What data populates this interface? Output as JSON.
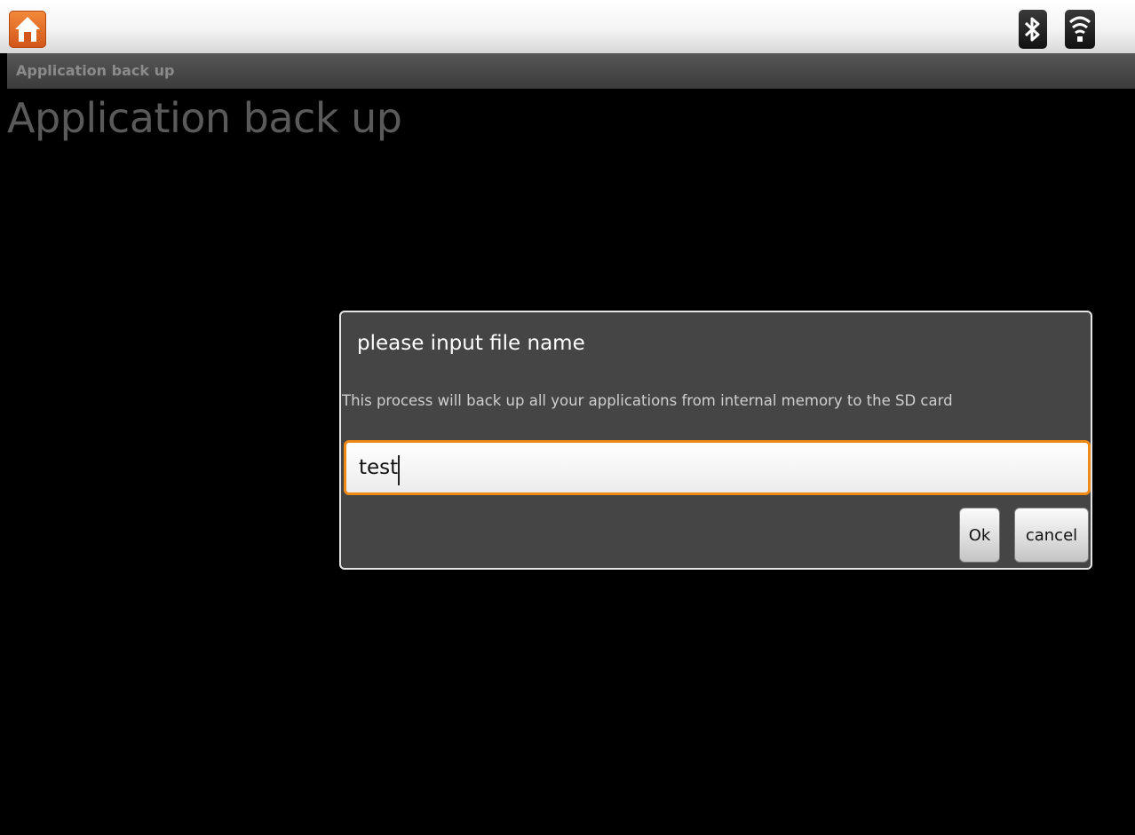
{
  "status_bar": {
    "icons": [
      "home-icon",
      "bluetooth-icon",
      "wifi-icon"
    ],
    "accent": "#e2651f"
  },
  "title_bar": {
    "label": "Application back up"
  },
  "page": {
    "title": "Application back up"
  },
  "dialog": {
    "title": "please input file name",
    "message": "This process will back up all your applications from internal memory to the SD card",
    "input_value": "test",
    "focus_color": "#f08a17",
    "ok_label": "Ok",
    "cancel_label": "cancel"
  }
}
